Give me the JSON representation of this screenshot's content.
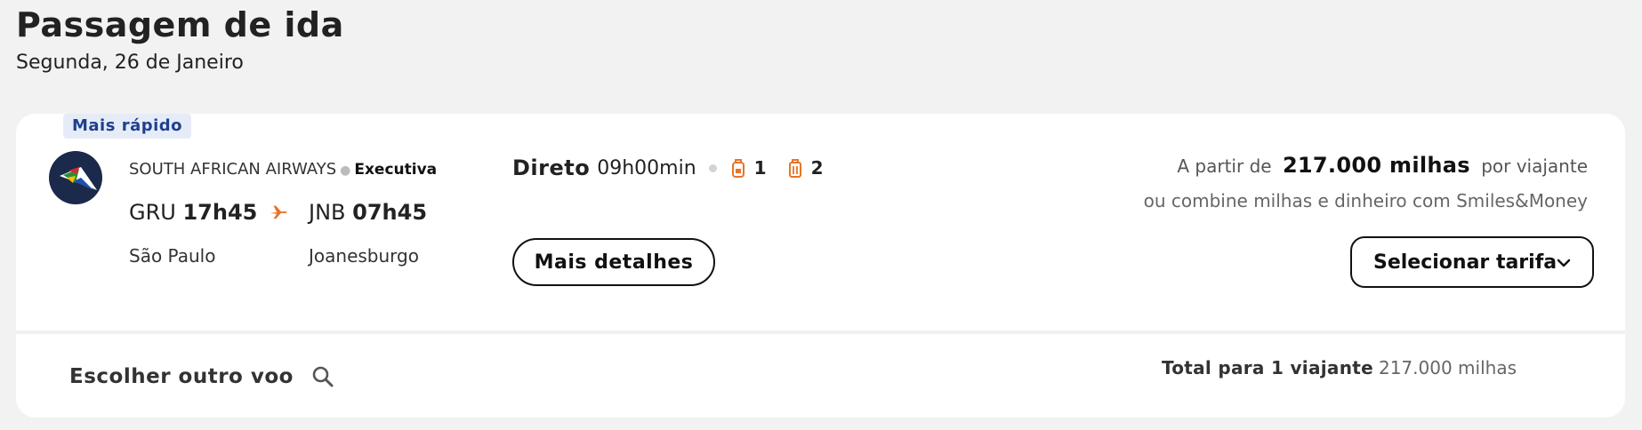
{
  "header": {
    "title": "Passagem de ida",
    "subtitle": "Segunda, 26 de Janeiro"
  },
  "flight": {
    "badge": "Mais rápido",
    "airline": "SOUTH AFRICAN AIRWAYS",
    "fare_class": "Executiva",
    "origin_code": "GRU",
    "origin_time": "17h45",
    "origin_city": "São Paulo",
    "dest_code": "JNB",
    "dest_time": "07h45",
    "dest_city": "Joanesburgo",
    "stops": "Direto",
    "duration": "09h00min",
    "carry_on_count": "1",
    "checked_bag_count": "2",
    "details_button": "Mais detalhes"
  },
  "price": {
    "prefix": "A partir de",
    "amount": "217.000 milhas",
    "suffix": "por viajante",
    "combine_text": "ou combine milhas e dinheiro com Smiles&Money",
    "select_button": "Selecionar tarifa"
  },
  "footer": {
    "other_flight": "Escolher outro voo",
    "total_label": "Total para 1 viajante",
    "total_value": "217.000 milhas"
  },
  "colors": {
    "accent_orange": "#e8742a",
    "badge_bg": "#e6ecf7",
    "badge_text": "#1f3f8f",
    "logo_navy": "#1b2a4a"
  },
  "icons": {
    "airline_logo": "south-african-airways-logo",
    "plane": "plane-icon",
    "carry_on": "backpack-icon",
    "checked_bag": "suitcase-icon",
    "chevron": "chevron-down-icon",
    "search": "search-icon"
  }
}
